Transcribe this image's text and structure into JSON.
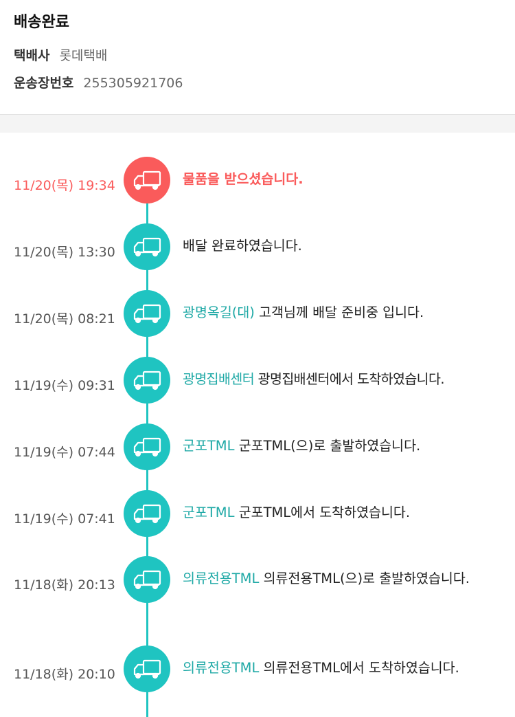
{
  "header": {
    "status_title": "배송완료",
    "courier_label": "택배사",
    "courier_value": "롯데택배",
    "invoice_label": "운송장번호",
    "invoice_value": "255305921706"
  },
  "colors": {
    "accent_teal": "#1fc4c1",
    "location_teal": "#1fa9a6",
    "highlight_red": "#fa5b5b"
  },
  "icons": {
    "status_icon": "delivery-truck-icon"
  },
  "events": [
    {
      "time": "11/20(목) 19:34",
      "location": "",
      "message": "물품을 받으셨습니다."
    },
    {
      "time": "11/20(목) 13:30",
      "location": "",
      "message": "배달 완료하였습니다."
    },
    {
      "time": "11/20(목) 08:21",
      "location": "광명옥길(대)",
      "message": "고객님께 배달 준비중 입니다."
    },
    {
      "time": "11/19(수) 09:31",
      "location": "광명집배센터",
      "message": "광명집배센터에서 도착하였습니다."
    },
    {
      "time": "11/19(수) 07:44",
      "location": "군포TML",
      "message": "군포TML(으)로 출발하였습니다."
    },
    {
      "time": "11/19(수) 07:41",
      "location": "군포TML",
      "message": "군포TML에서 도착하였습니다."
    },
    {
      "time": "11/18(화) 20:13",
      "location": "의류전용TML",
      "message": "의류전용TML(으)로 출발하였습니다."
    },
    {
      "time": "11/18(화) 20:10",
      "location": "의류전용TML",
      "message": "의류전용TML에서 도착하였습니다."
    }
  ]
}
